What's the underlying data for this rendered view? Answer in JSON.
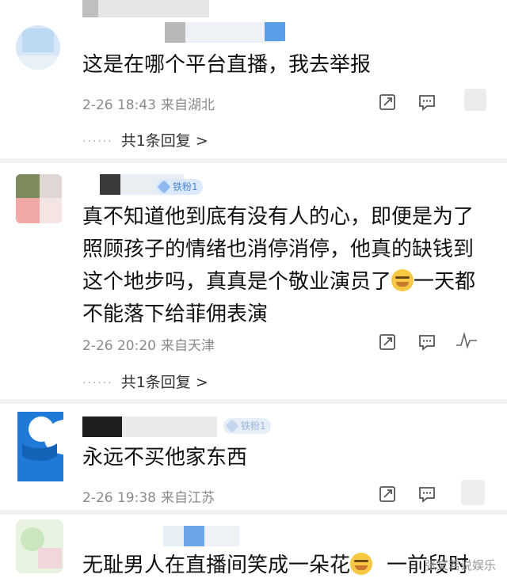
{
  "comments": [
    {
      "text": "这是在哪个平台直播，我去举报",
      "time": "2-26 18:43",
      "location": "来自湖北",
      "reply_text": "共1条回复 >"
    },
    {
      "badge": "铁粉1",
      "lines": [
        "真不知道他到底有没有人的心，即便是为了",
        "照顾孩子的情绪也消停消停，他真的缺钱到",
        "这个地步吗，真真是个敬业演员了",
        "一天都",
        "不能落下给菲佣表演"
      ],
      "emoji": "weary-face-emoji",
      "time": "2-26 20:20",
      "location": "来自天津",
      "reply_text": "共1条回复 >"
    },
    {
      "badge": "铁粉1",
      "text": "永远不买他家东西",
      "time": "2-26 19:38",
      "location": "来自江苏"
    },
    {
      "text_start": "无耻男人在直播间笑成一朵花",
      "text_end": "一前段时",
      "emoji": "grimace-face-emoji"
    }
  ],
  "watermark": "张文若说娱乐",
  "icons": {
    "share": "share-icon",
    "comment": "comment-icon",
    "like": "like-icon"
  },
  "colors": {
    "badge_bg": "#dbe9fb",
    "badge_text": "#4a86d6",
    "meta": "#8a8a8a"
  }
}
